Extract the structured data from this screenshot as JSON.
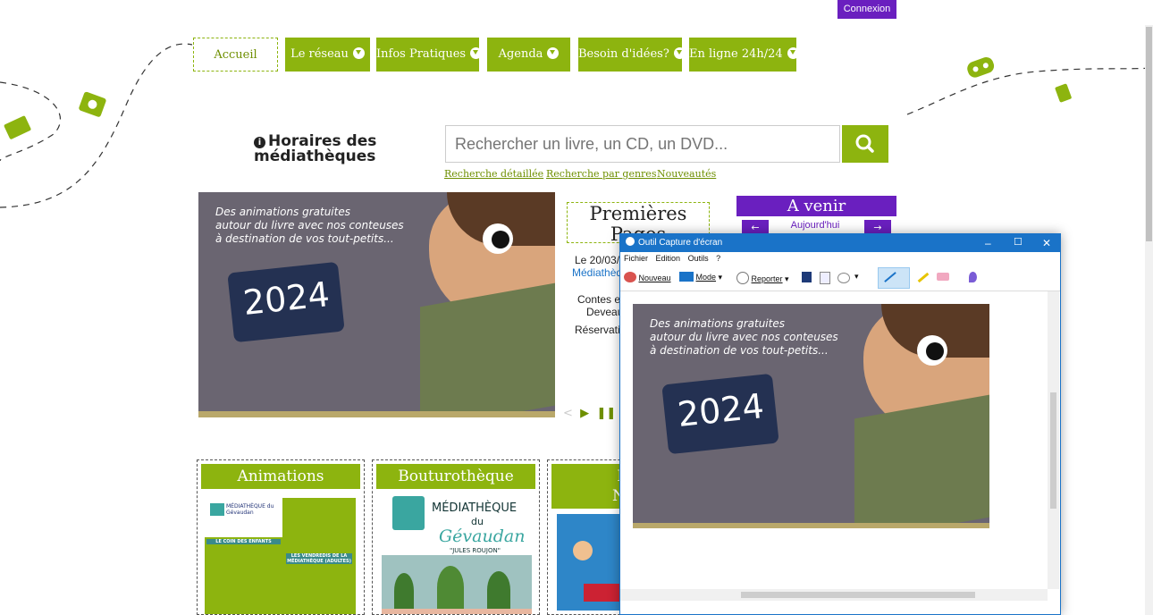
{
  "header": {
    "login_label": "Connexion"
  },
  "nav": {
    "items": [
      {
        "label": "Accueil"
      },
      {
        "label": "Le réseau"
      },
      {
        "label": "Infos Pratiques"
      },
      {
        "label": "Agenda"
      },
      {
        "label": "Besoin d'idées?"
      },
      {
        "label": "En ligne 24h/24"
      }
    ]
  },
  "hours": {
    "label": "Horaires des médiathèques"
  },
  "search": {
    "placeholder": "Rechercher un livre, un CD, un DVD...",
    "links": [
      "Recherche détaillée",
      "Recherche par genres",
      "Nouveautés"
    ]
  },
  "slider": {
    "caption_line1": "Des animations gratuites",
    "caption_line2": "autour du livre avec nos conteuses",
    "caption_line3": "à destination de vos tout-petits...",
    "year": "2024"
  },
  "event": {
    "title": "Premières Pages",
    "date_prefix": "Le 20/03/2",
    "place": "Médiathèqu",
    "line1": "Contes et",
    "line2": "Deveau",
    "line3": "Réservatio"
  },
  "upcoming": {
    "title": "A venir",
    "today": "Aujourd'hui",
    "prev": "←",
    "next": "→"
  },
  "cards": [
    {
      "title": "Animations",
      "logo": "MÉDIATHÈQUE du Gévaudan",
      "subtitle": "LE COIN DES ENFANTS",
      "subtitle2": "LES VENDREDIS DE LA MÉDIATHÈQUE (ADULTES)"
    },
    {
      "title": "Bouturothèque",
      "logo_line1": "MÉDIATHÈQUE",
      "logo_line2": "du",
      "logo_line3": "Gévaudan",
      "logo_line4": "\"JULES ROUJON\""
    },
    {
      "title_line1": "Res",
      "title_line2": "Num"
    }
  ],
  "capture_window": {
    "title": "Outil Capture d'écran",
    "menu": [
      "Fichier",
      "Edition",
      "Outils",
      "?"
    ],
    "tools": {
      "new": "Nouveau",
      "mode": "Mode",
      "delay": "Reporter"
    },
    "caption_line1": "Des animations gratuites",
    "caption_line2": "autour du livre avec nos conteuses",
    "caption_line3": "à destination de vos tout-petits...",
    "year": "2024"
  },
  "colors": {
    "green": "#8db40f",
    "purple": "#6a1fbf",
    "window_blue": "#1a73c8"
  }
}
